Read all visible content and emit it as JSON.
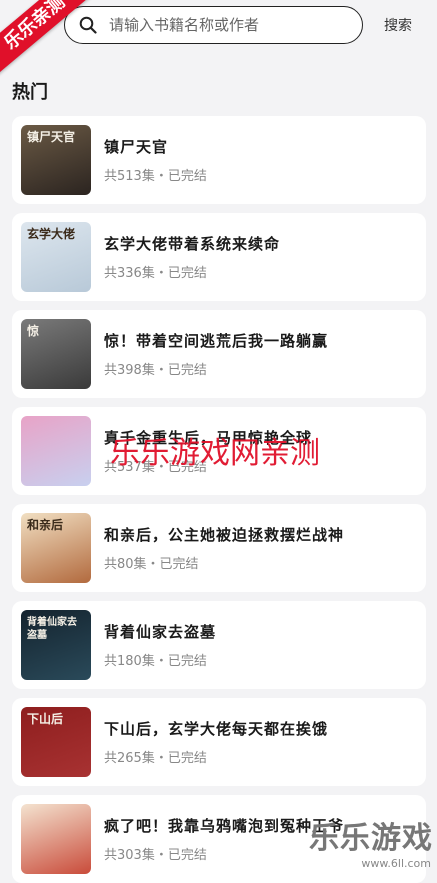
{
  "search": {
    "placeholder": "请输入书籍名称或作者",
    "button": "搜索"
  },
  "ribbon": "乐乐亲测",
  "section_title": "热门",
  "books": [
    {
      "title": "镇尸天官",
      "meta": "共513集・已完结",
      "cover_text": "镇尸天官",
      "cover_colors": [
        "#6b5a45",
        "#2b2420"
      ]
    },
    {
      "title": "玄学大佬带着系统来续命",
      "meta": "共336集・已完结",
      "cover_text": "玄学大佬",
      "cover_colors": [
        "#dde6ee",
        "#b8c9d8"
      ]
    },
    {
      "title": "惊！带着空间逃荒后我一路躺赢",
      "meta": "共398集・已完结",
      "cover_text": "惊",
      "cover_colors": [
        "#7a7a7a",
        "#3a3a3a"
      ]
    },
    {
      "title": "真千金重生后，马甲惊艳全球",
      "meta": "共537集・已完结",
      "cover_text": "",
      "cover_colors": [
        "#e8a3c7",
        "#c8d0ef"
      ]
    },
    {
      "title": "和亲后，公主她被迫拯救摆烂战神",
      "meta": "共80集・已完结",
      "cover_text": "和亲后",
      "cover_colors": [
        "#f1dfc2",
        "#b26a3e"
      ]
    },
    {
      "title": "背着仙家去盗墓",
      "meta": "共180集・已完结",
      "cover_text": "背着仙家去盗墓",
      "cover_colors": [
        "#14232e",
        "#2a4a5a"
      ]
    },
    {
      "title": "下山后，玄学大佬每天都在挨饿",
      "meta": "共265集・已完结",
      "cover_text": "下山后",
      "cover_colors": [
        "#8e1e1e",
        "#a83232"
      ]
    },
    {
      "title": "疯了吧！我靠乌鸦嘴泡到冤种王爷",
      "meta": "共303集・已完结",
      "cover_text": "",
      "cover_colors": [
        "#f4e3d0",
        "#c94b3a"
      ]
    }
  ],
  "watermark_center": "乐乐游戏网亲测",
  "watermark_corner": {
    "big": "乐乐游戏",
    "small": "www.6ll.com"
  }
}
